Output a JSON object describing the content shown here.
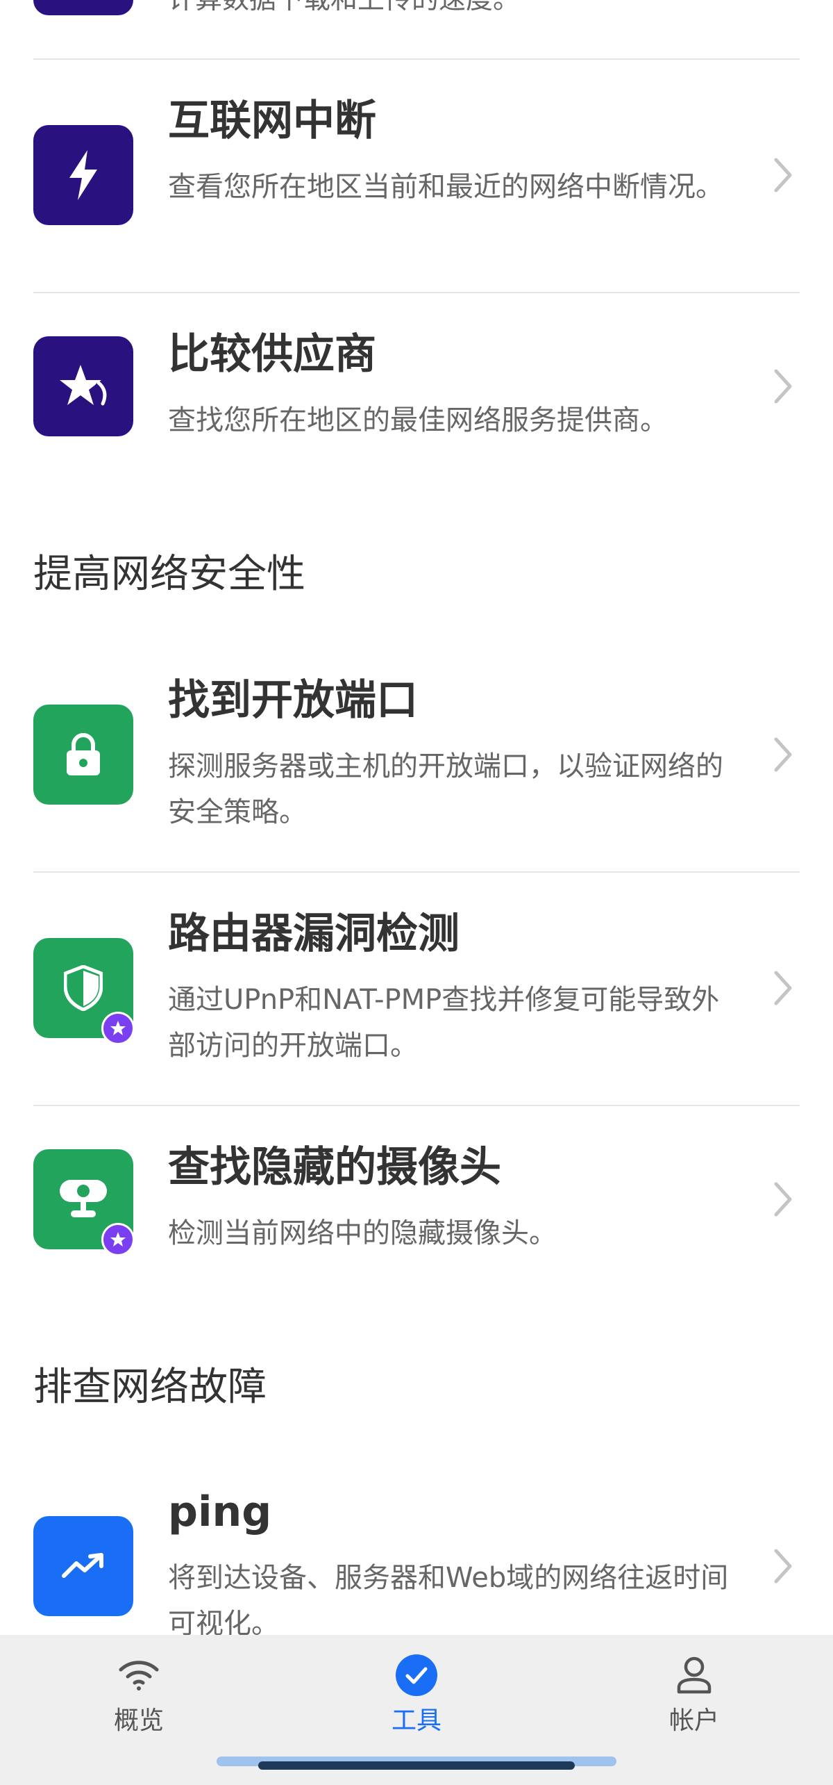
{
  "partial_item": {
    "description": "计算数据下载和上传的速度。"
  },
  "sections": [
    {
      "heading": "",
      "items": [
        {
          "title": "互联网中断",
          "description": "查看您所在地区当前和最近的网络中断情况。",
          "icon": "lightning-icon",
          "icon_color": "#2a1180",
          "premium": false
        },
        {
          "title": "比较供应商",
          "description": "查找您所在地区的最佳网络服务提供商。",
          "icon": "star-compare-icon",
          "icon_color": "#2a1180",
          "premium": false
        }
      ]
    },
    {
      "heading": "提高网络安全性",
      "items": [
        {
          "title": "找到开放端口",
          "description": "探测服务器或主机的开放端口，以验证网络的安全策略。",
          "icon": "lock-icon",
          "icon_color": "#22a45d",
          "premium": false
        },
        {
          "title": "路由器漏洞检测",
          "description": "通过UPnP和NAT-PMP查找并修复可能导致外部访问的开放端口。",
          "icon": "shield-icon",
          "icon_color": "#22a45d",
          "premium": true
        },
        {
          "title": "查找隐藏的摄像头",
          "description": "检测当前网络中的隐藏摄像头。",
          "icon": "camera-icon",
          "icon_color": "#22a45d",
          "premium": true
        }
      ]
    },
    {
      "heading": "排查网络故障",
      "items": [
        {
          "title": "ping",
          "description": "将到达设备、服务器和Web域的网络往返时间可视化。",
          "icon": "trend-up-icon",
          "icon_color": "#1a6ef5",
          "premium": false
        }
      ]
    }
  ],
  "bottom_nav": {
    "tabs": [
      {
        "label": "概览",
        "icon": "wifi-icon",
        "active": false
      },
      {
        "label": "工具",
        "icon": "check-circle-icon",
        "active": true
      },
      {
        "label": "帐户",
        "icon": "person-icon",
        "active": false
      }
    ],
    "accent_color": "#1a6ef5"
  }
}
